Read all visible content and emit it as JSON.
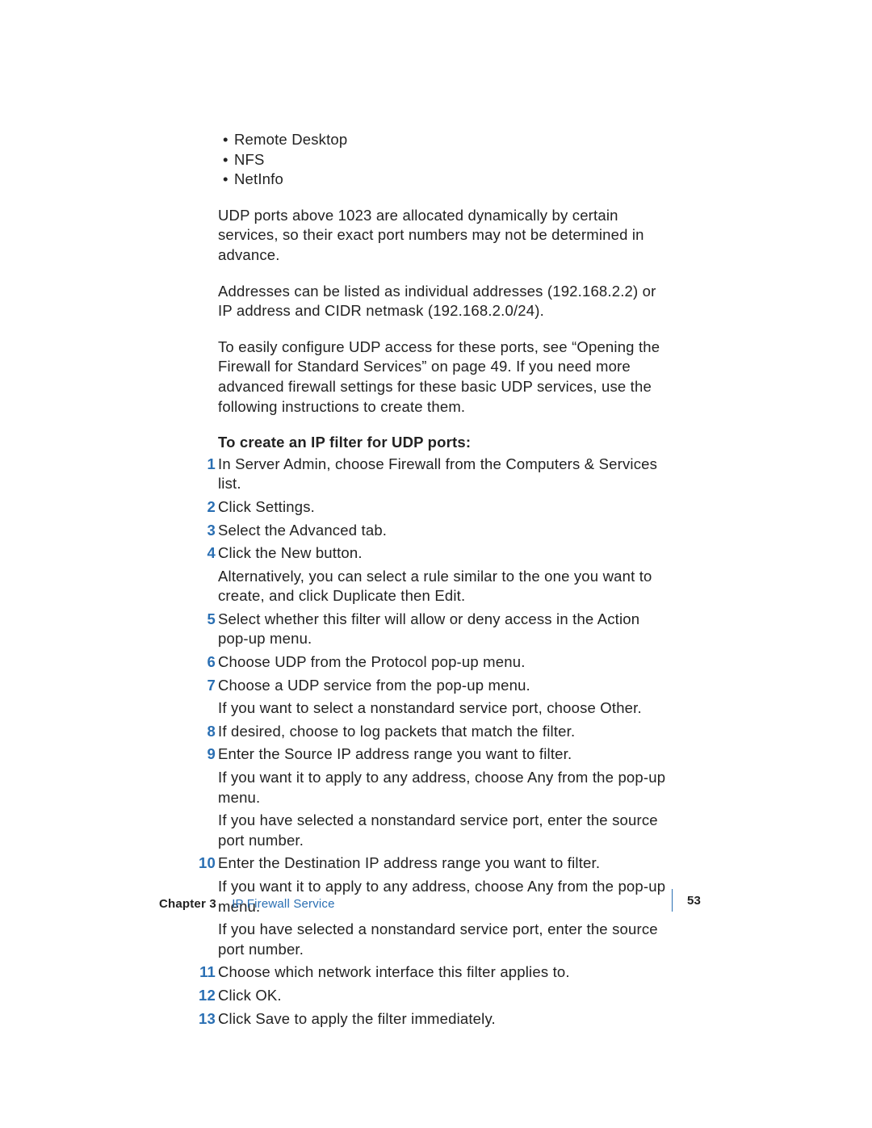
{
  "bullets": [
    "Remote Desktop",
    "NFS",
    "NetInfo"
  ],
  "para1": "UDP ports above 1023 are allocated dynamically by certain services, so their exact port numbers may not be determined in advance.",
  "para2": "Addresses can be listed as individual addresses (192.168.2.2) or IP address and CIDR netmask (192.168.2.0/24).",
  "para3": "To easily configure UDP access for these ports, see “Opening the Firewall for Standard Services” on page 49. If you need more advanced firewall settings for these basic UDP services, use the following instructions to create them.",
  "section_head": "To create an IP filter for UDP ports:",
  "steps": [
    {
      "n": "1",
      "text": "In Server Admin, choose Firewall from the Computers & Services list."
    },
    {
      "n": "2",
      "text": "Click Settings."
    },
    {
      "n": "3",
      "text": "Select the Advanced tab."
    },
    {
      "n": "4",
      "text": "Click the New button.",
      "subs": [
        "Alternatively, you can select a rule similar to the one you want to create, and click Duplicate then Edit."
      ]
    },
    {
      "n": "5",
      "text": "Select whether this filter will allow or deny access in the Action pop-up menu."
    },
    {
      "n": "6",
      "text": "Choose UDP from the Protocol pop-up menu."
    },
    {
      "n": "7",
      "text": "Choose a UDP service from the pop-up menu.",
      "subs": [
        "If you want to select a nonstandard service port, choose Other."
      ]
    },
    {
      "n": "8",
      "text": "If desired, choose to log packets that match the filter."
    },
    {
      "n": "9",
      "text": "Enter the Source IP address range you want to filter.",
      "subs": [
        "If you want it to apply to any address, choose Any from the pop-up menu.",
        "If you have selected a nonstandard service port, enter the source port number."
      ]
    },
    {
      "n": "10",
      "text": "Enter the Destination IP address range you want to filter.",
      "subs": [
        "If you want it to apply to any address, choose Any from the pop-up menu.",
        "If you have selected a nonstandard service port, enter the source port number."
      ]
    },
    {
      "n": "11",
      "text": "Choose which network interface this filter applies to."
    },
    {
      "n": "12",
      "text": "Click OK."
    },
    {
      "n": "13",
      "text": "Click Save to apply the filter immediately."
    }
  ],
  "footer": {
    "chapter_label": "Chapter 3",
    "chapter_title": "IP Firewall Service",
    "page_number": "53"
  }
}
